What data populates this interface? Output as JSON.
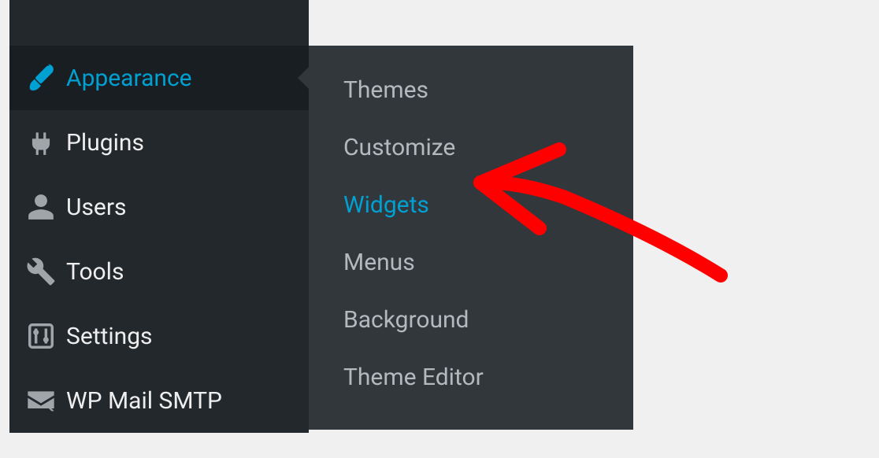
{
  "sidebar": {
    "items": [
      {
        "label": "Appearance",
        "icon": "paintbrush",
        "active": true
      },
      {
        "label": "Plugins",
        "icon": "plug",
        "active": false
      },
      {
        "label": "Users",
        "icon": "user",
        "active": false
      },
      {
        "label": "Tools",
        "icon": "wrench",
        "active": false
      },
      {
        "label": "Settings",
        "icon": "sliders",
        "active": false
      },
      {
        "label": "WP Mail SMTP",
        "icon": "mail",
        "active": false
      }
    ]
  },
  "submenu": {
    "items": [
      {
        "label": "Themes",
        "active": false
      },
      {
        "label": "Customize",
        "active": false
      },
      {
        "label": "Widgets",
        "active": true
      },
      {
        "label": "Menus",
        "active": false
      },
      {
        "label": "Background",
        "active": false
      },
      {
        "label": "Theme Editor",
        "active": false
      }
    ]
  }
}
